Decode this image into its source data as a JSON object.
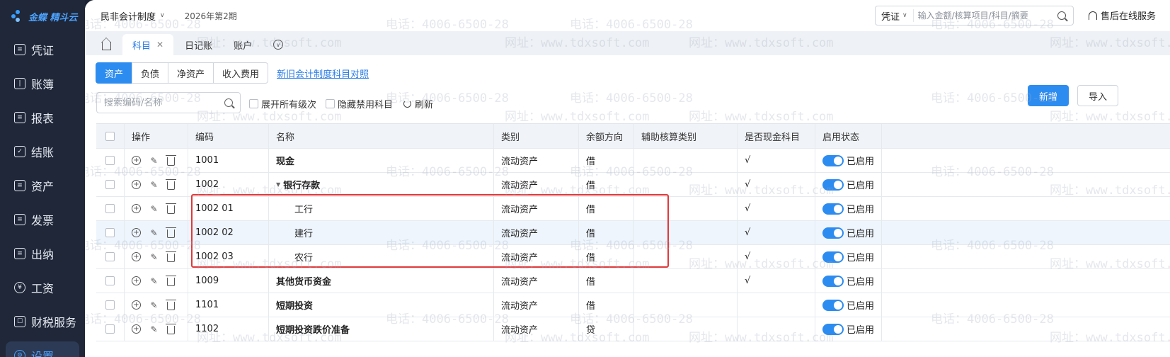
{
  "sidebar": {
    "logo_text": "金蝶 精斗云",
    "items": [
      {
        "label": "凭证",
        "icon": "voucher-icon"
      },
      {
        "label": "账簿",
        "icon": "book-icon"
      },
      {
        "label": "报表",
        "icon": "report-icon"
      },
      {
        "label": "结账",
        "icon": "close-account-icon"
      },
      {
        "label": "资产",
        "icon": "asset-icon"
      },
      {
        "label": "发票",
        "icon": "invoice-icon"
      },
      {
        "label": "出纳",
        "icon": "cashier-icon"
      },
      {
        "label": "工资",
        "icon": "salary-icon"
      },
      {
        "label": "财税服务",
        "icon": "tax-service-icon"
      },
      {
        "label": "设置",
        "icon": "settings-icon"
      }
    ]
  },
  "topbar": {
    "system": "民非会计制度",
    "period": "2026年第2期",
    "search_type": "凭证",
    "search_placeholder": "输入金额/核算项目/科目/摘要",
    "service": "售后在线服务"
  },
  "tabs": [
    {
      "label": "科目",
      "active": true
    },
    {
      "label": "日记账",
      "active": false
    },
    {
      "label": "账户",
      "active": false
    }
  ],
  "categories": [
    "资产",
    "负债",
    "净资产",
    "收入费用"
  ],
  "compare_link": "新旧会计制度科目对照",
  "filters": {
    "search_placeholder": "搜索编码/名称",
    "expand_label": "展开所有级次",
    "hide_label": "隐藏禁用科目",
    "refresh_label": "刷新"
  },
  "actions": {
    "add": "新增",
    "import": "导入"
  },
  "table": {
    "headers": [
      "操作",
      "编码",
      "名称",
      "类别",
      "余额方向",
      "辅助核算类别",
      "是否现金科目",
      "启用状态"
    ],
    "rows": [
      {
        "code": "1001",
        "name": "现金",
        "type": "流动资产",
        "dir": "借",
        "aux": "",
        "cash": "√",
        "status": "已启用"
      },
      {
        "code": "1002",
        "name": "银行存款",
        "type": "流动资产",
        "dir": "借",
        "aux": "",
        "cash": "√",
        "status": "已启用"
      },
      {
        "code": "1002 01",
        "name": "工行",
        "type": "流动资产",
        "dir": "借",
        "aux": "",
        "cash": "√",
        "status": "已启用"
      },
      {
        "code": "1002 02",
        "name": "建行",
        "type": "流动资产",
        "dir": "借",
        "aux": "",
        "cash": "√",
        "status": "已启用"
      },
      {
        "code": "1002 03",
        "name": "农行",
        "type": "流动资产",
        "dir": "借",
        "aux": "",
        "cash": "√",
        "status": "已启用"
      },
      {
        "code": "1009",
        "name": "其他货币资金",
        "type": "流动资产",
        "dir": "借",
        "aux": "",
        "cash": "√",
        "status": "已启用"
      },
      {
        "code": "1101",
        "name": "短期投资",
        "type": "流动资产",
        "dir": "借",
        "aux": "",
        "cash": "",
        "status": "已启用"
      },
      {
        "code": "1102",
        "name": "短期投资跌价准备",
        "type": "流动资产",
        "dir": "贷",
        "aux": "",
        "cash": "",
        "status": "已启用"
      }
    ]
  },
  "watermark": {
    "phone": "电话：4006-6500-28",
    "site": "网址：www.tdxsoft.com"
  },
  "colors": {
    "accent": "#2d8cf0",
    "sidebar_bg": "#1f2738",
    "highlight": "#e0393b"
  }
}
